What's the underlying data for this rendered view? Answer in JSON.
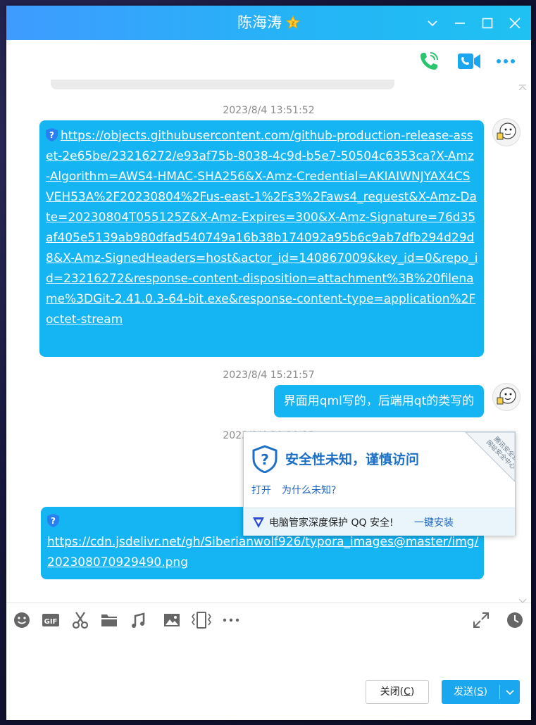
{
  "window": {
    "title": "陈海涛"
  },
  "messages": {
    "m1": {
      "time": "2023/8/4 13:51:52",
      "link": "https://objects.githubusercontent.com/github-production-release-asset-2e65be/23216272/e93af75b-8038-4c9d-b5e7-50504c6353ca?X-Amz-Algorithm=AWS4-HMAC-SHA256&X-Amz-Credential=AKIAIWNJYAX4CSVEH53A%2F20230804%2Fus-east-1%2Fs3%2Faws4_request&X-Amz-Date=20230804T055125Z&X-Amz-Expires=300&X-Amz-Signature=76d35af405e5139ab980dfad540749a16b38b174092a95b6c9ab7dfb294d29d8&X-Amz-SignedHeaders=host&actor_id=140867009&key_id=0&repo_id=23216272&response-content-disposition=attachment%3B%20filename%3DGit-2.41.0.3-64-bit.exe&response-content-type=application%2Foctet-stream"
    },
    "m2": {
      "time": "2023/8/4 15:21:57",
      "text": "界面用qml写的，后端用qt的类写的"
    },
    "m3": {
      "time": "2023/8/4 20:20:13",
      "link": "https://cdn.jsdelivr.net/gh/Siberianwolf926/typora_images@master/img/202308070929490.png"
    }
  },
  "security_popup": {
    "title": "安全性未知，谨慎访问",
    "open": "打开",
    "why": "为什么未知?",
    "corner_line1": "腾讯安全云",
    "corner_line2": "网址安全中心",
    "footer_text": "电脑管家深度保护 QQ 安全!",
    "install": "一键安装"
  },
  "input": {
    "close_label": "关闭(",
    "close_key": "C",
    "close_end": ")",
    "send_label": "发送(",
    "send_key": "S",
    "send_end": ")"
  },
  "icons": {
    "call": "phone-icon",
    "video": "video-icon",
    "more": "more-icon",
    "emoji": "emoji-icon",
    "gif": "gif-icon",
    "screenshot": "scissors-icon",
    "file": "folder-icon",
    "music": "music-icon",
    "image": "image-icon",
    "shake": "shake-icon",
    "expand": "expand-icon",
    "history": "clock-icon"
  },
  "colors": {
    "bubble": "#15b4f2",
    "title_gradient_start": "#3f9bff",
    "title_gradient_end": "#1fc1f2",
    "send_button": "#1aa7ef",
    "call_green": "#2ac56e",
    "video_blue": "#1aa7ef"
  }
}
